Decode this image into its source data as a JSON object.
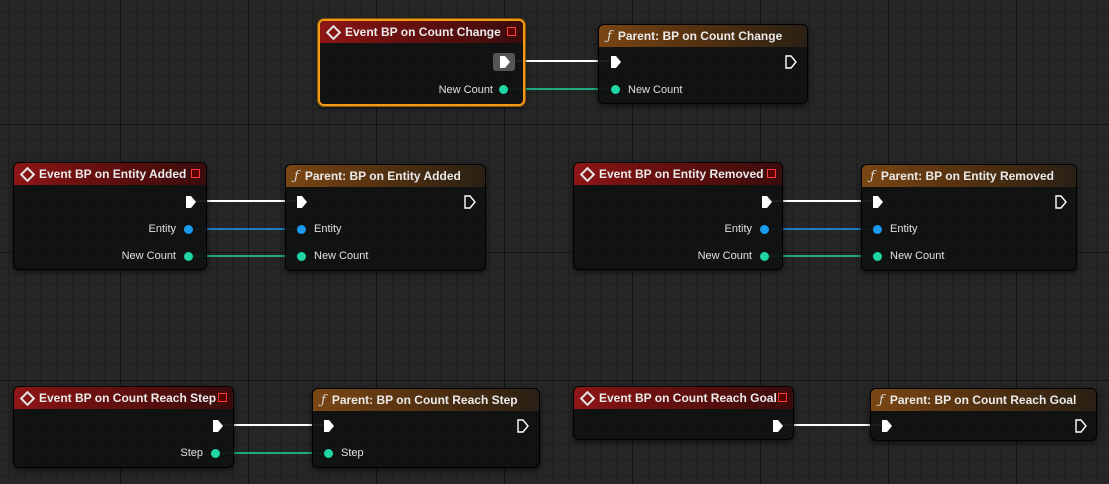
{
  "colors": {
    "exec": "#ffffff",
    "count_pin": "#1fd6a4",
    "entity_pin": "#1a9bef",
    "selected_border": "#f29a18"
  },
  "icons": {
    "event": "event-diamond-icon",
    "function": "function-f-icon",
    "delegate": "delegate-square-icon"
  },
  "nodes": {
    "ev_count_change": {
      "title": "Event BP on Count Change",
      "pin_new_count": "New Count"
    },
    "pa_count_change": {
      "title": "Parent: BP on Count Change",
      "pin_new_count": "New Count"
    },
    "ev_entity_added": {
      "title": "Event BP on Entity Added",
      "pin_entity": "Entity",
      "pin_new_count": "New Count"
    },
    "pa_entity_added": {
      "title": "Parent: BP on Entity Added",
      "pin_entity": "Entity",
      "pin_new_count": "New Count"
    },
    "ev_entity_removed": {
      "title": "Event BP on Entity Removed",
      "pin_entity": "Entity",
      "pin_new_count": "New Count"
    },
    "pa_entity_removed": {
      "title": "Parent: BP on Entity Removed",
      "pin_entity": "Entity",
      "pin_new_count": "New Count"
    },
    "ev_reach_step": {
      "title": "Event BP on Count Reach Step",
      "pin_step": "Step"
    },
    "pa_reach_step": {
      "title": "Parent: BP on Count Reach Step",
      "pin_step": "Step"
    },
    "ev_reach_goal": {
      "title": "Event BP on Count Reach Goal"
    },
    "pa_reach_goal": {
      "title": "Parent: BP on Count Reach Goal"
    }
  }
}
